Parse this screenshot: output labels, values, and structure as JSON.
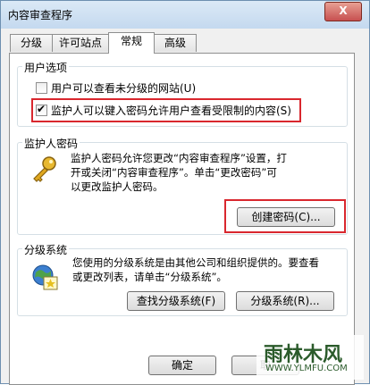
{
  "window": {
    "title": "内容审查程序",
    "close_label": "X"
  },
  "tabs": [
    {
      "label": "分级"
    },
    {
      "label": "许可站点"
    },
    {
      "label": "常规"
    },
    {
      "label": "高级"
    }
  ],
  "user_options": {
    "label": "用户选项",
    "opt1": {
      "label": "用户可以查看未分级的网站(U)",
      "checked": false
    },
    "opt2": {
      "label": "监护人可以键入密码允许用户查看受限制的内容(S)",
      "checked": true
    }
  },
  "supervisor_password": {
    "label": "监护人密码",
    "line1": "监护人密码允许您更改“内容审查程序”设置，打",
    "line2": "开或关闭“内容审查程序”。单击“更改密码”可",
    "line3": "以更改监护人密码。",
    "button": "创建密码(C)..."
  },
  "rating_systems": {
    "label": "分级系统",
    "line1": "您使用的分级系统是由其他公司和组织提供的。要查看",
    "line2": "或更改列表，请单击“分级系统”。",
    "find_button": "查找分级系统(F)",
    "systems_button": "分级系统(R)..."
  },
  "footer": {
    "ok_button": "确定",
    "cancel_button": "取"
  },
  "watermark": {
    "text": "雨林木风",
    "url": "WWW.YLMFU.COM"
  }
}
